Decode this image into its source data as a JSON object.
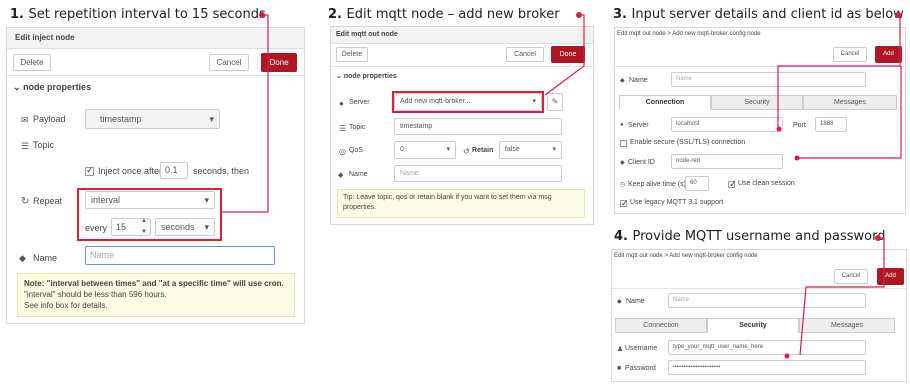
{
  "step1": {
    "number": "1.",
    "title": "Set repetition interval to 15 seconds",
    "header": "Edit inject node",
    "delete": "Delete",
    "cancel": "Cancel",
    "done": "Done",
    "section": "node properties",
    "payload_label": "Payload",
    "payload_value": "timestamp",
    "topic_label": "Topic",
    "inject_once": "Inject once after",
    "inject_value": "0.1",
    "inject_suffix": "seconds, then",
    "repeat_label": "Repeat",
    "repeat_value": "interval",
    "every": "every",
    "every_value": "15",
    "unit": "seconds",
    "name_label": "Name",
    "name_placeholder": "Name",
    "note_bold": "Note: \"interval between times\" and \"at a specific time\" will use cron.",
    "note_line2": "\"interval\" should be less than 596 hours.",
    "note_line3": "See info box for details."
  },
  "step2": {
    "number": "2.",
    "title": "Edit mqtt node – add new broker",
    "header": "Edit mqtt out node",
    "delete": "Delete",
    "cancel": "Cancel",
    "done": "Done",
    "section": "node properties",
    "server_label": "Server",
    "server_value": "Add new mqtt-broker...",
    "topic_label": "Topic",
    "topic_value": "timestamp",
    "qos_label": "QoS",
    "qos_value": "0",
    "retain_label": "Retain",
    "retain_value": "false",
    "name_label": "Name",
    "name_placeholder": "Name",
    "tip": "Tip: Leave topic, qos or retain blank if you want to set them via msg properties."
  },
  "step3": {
    "number": "3.",
    "title": "Input server details and client id as below",
    "breadcrumb": "Edit mqtt out node > Add new mqtt-broker config node",
    "cancel": "Cancel",
    "add": "Add",
    "name_label": "Name",
    "name_placeholder": "Name",
    "tabs": [
      "Connection",
      "Security",
      "Messages"
    ],
    "server_label": "Server",
    "server_value": "localhost",
    "port_label": "Port",
    "port_value": "1883",
    "tls": "Enable secure (SSL/TLS) connection",
    "client_label": "Client ID",
    "client_value": "node-red",
    "keepalive_label": "Keep alive time (s)",
    "keepalive_value": "60",
    "clean_session": "Use clean session",
    "legacy": "Use legacy MQTT 3.1 support"
  },
  "step4": {
    "number": "4.",
    "title": "Provide MQTT username and password",
    "breadcrumb": "Edit mqtt out node > Add new mqtt-broker config node",
    "cancel": "Cancel",
    "add": "Add",
    "name_label": "Name",
    "name_placeholder": "Name",
    "tabs": [
      "Connection",
      "Security",
      "Messages"
    ],
    "username_label": "Username",
    "username_value": "type_your_mqtt_user_name_here",
    "password_label": "Password",
    "password_value": "•••••••••••••••••••••••••••"
  },
  "colors": {
    "accent": "#ad1625",
    "annotation": "#d6203f"
  }
}
